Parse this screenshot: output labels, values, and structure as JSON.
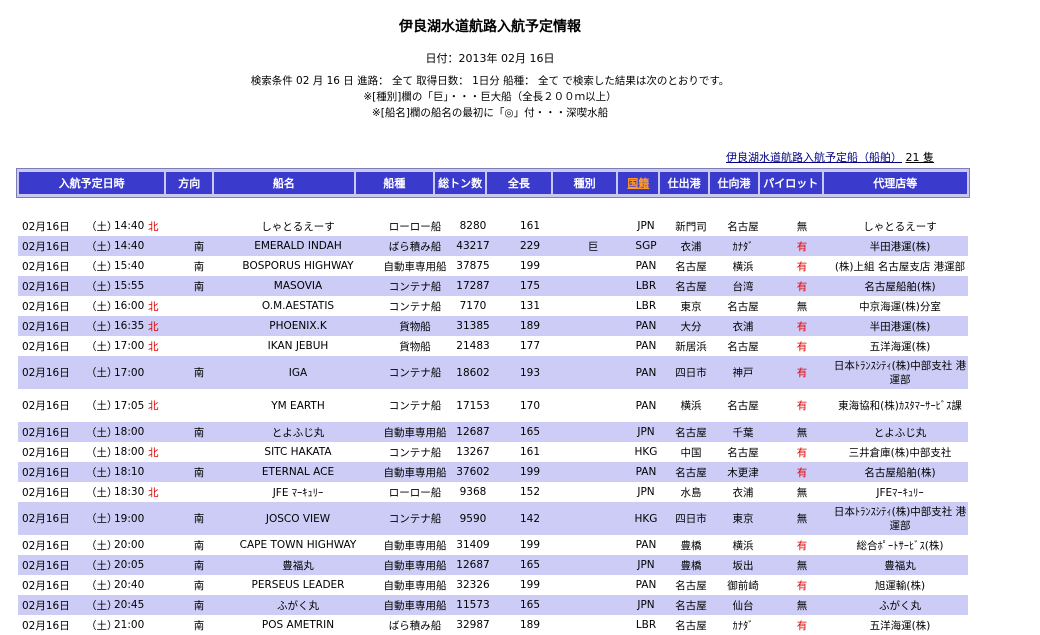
{
  "header": {
    "title": "伊良湖水道航路入航予定情報",
    "date_line": "日付：2013年 02月 16日",
    "condition_line": "検索条件 02 月 16 日 進路： 全て 取得日数： 1日分 船種： 全て で検索した結果は次のとおりです。",
    "note1": "※[種別]欄の「巨」・・・巨大船（全長２００ｍ以上）",
    "note2": "※[船名]欄の船名の最初に「◎」付・・・深喫水船"
  },
  "summary": {
    "link_text": "伊良湖水道航路入航予定船（船舶）",
    "count": "21 隻"
  },
  "columns": [
    "入航予定日時",
    "方向",
    "船名",
    "船種",
    "総トン数",
    "全長",
    "種別",
    "国籍",
    "仕出港",
    "仕向港",
    "パイロット",
    "代理店等"
  ],
  "rows": [
    {
      "date": "02月16日",
      "dow": "（土）",
      "time": "14:40",
      "dir": "北",
      "name": "しゃとるえーす",
      "type": "ローロー船",
      "gt": "8280",
      "len": "161",
      "cls": "",
      "flag": "JPN",
      "from": "新門司",
      "to": "名古屋",
      "pilot": "無",
      "agent": "しゃとるえーす"
    },
    {
      "date": "02月16日",
      "dow": "（土）",
      "time": "14:40",
      "dir": "南",
      "name": "EMERALD INDAH",
      "type": "ばら積み船",
      "gt": "43217",
      "len": "229",
      "cls": "巨",
      "flag": "SGP",
      "from": "衣浦",
      "to": "ｶﾅﾀﾞ",
      "pilot": "有",
      "agent": "半田港運(株)"
    },
    {
      "date": "02月16日",
      "dow": "（土）",
      "time": "15:40",
      "dir": "南",
      "name": "BOSPORUS HIGHWAY",
      "type": "自動車専用船",
      "gt": "37875",
      "len": "199",
      "cls": "",
      "flag": "PAN",
      "from": "名古屋",
      "to": "横浜",
      "pilot": "有",
      "agent": "(株)上組 名古屋支店 港運部"
    },
    {
      "date": "02月16日",
      "dow": "（土）",
      "time": "15:55",
      "dir": "南",
      "name": "MASOVIA",
      "type": "コンテナ船",
      "gt": "17287",
      "len": "175",
      "cls": "",
      "flag": "LBR",
      "from": "名古屋",
      "to": "台湾",
      "pilot": "有",
      "agent": "名古屋船舶(株)"
    },
    {
      "date": "02月16日",
      "dow": "（土）",
      "time": "16:00",
      "dir": "北",
      "name": "O.M.AESTATIS",
      "type": "コンテナ船",
      "gt": "7170",
      "len": "131",
      "cls": "",
      "flag": "LBR",
      "from": "東京",
      "to": "名古屋",
      "pilot": "無",
      "agent": "中京海運(株)分室"
    },
    {
      "date": "02月16日",
      "dow": "（土）",
      "time": "16:35",
      "dir": "北",
      "name": "PHOENIX.K",
      "type": "貨物船",
      "gt": "31385",
      "len": "189",
      "cls": "",
      "flag": "PAN",
      "from": "大分",
      "to": "衣浦",
      "pilot": "有",
      "agent": "半田港運(株)"
    },
    {
      "date": "02月16日",
      "dow": "（土）",
      "time": "17:00",
      "dir": "北",
      "name": "IKAN JEBUH",
      "type": "貨物船",
      "gt": "21483",
      "len": "177",
      "cls": "",
      "flag": "PAN",
      "from": "新居浜",
      "to": "名古屋",
      "pilot": "有",
      "agent": "五洋海運(株)"
    },
    {
      "date": "02月16日",
      "dow": "（土）",
      "time": "17:00",
      "dir": "南",
      "name": "IGA",
      "type": "コンテナ船",
      "gt": "18602",
      "len": "193",
      "cls": "",
      "flag": "PAN",
      "from": "四日市",
      "to": "神戸",
      "pilot": "有",
      "agent": "日本ﾄﾗﾝｽｼﾃｨ(株)中部支社 港運部"
    },
    {
      "date": "02月16日",
      "dow": "（土）",
      "time": "17:05",
      "dir": "北",
      "name": "YM EARTH",
      "type": "コンテナ船",
      "gt": "17153",
      "len": "170",
      "cls": "",
      "flag": "PAN",
      "from": "横浜",
      "to": "名古屋",
      "pilot": "有",
      "agent": "東海協和(株)ｶｽﾀﾏｰｻｰﾋﾞｽ課"
    },
    {
      "date": "02月16日",
      "dow": "（土）",
      "time": "18:00",
      "dir": "南",
      "name": "とよふじ丸",
      "type": "自動車専用船",
      "gt": "12687",
      "len": "165",
      "cls": "",
      "flag": "JPN",
      "from": "名古屋",
      "to": "千葉",
      "pilot": "無",
      "agent": "とよふじ丸"
    },
    {
      "date": "02月16日",
      "dow": "（土）",
      "time": "18:00",
      "dir": "北",
      "name": "SITC HAKATA",
      "type": "コンテナ船",
      "gt": "13267",
      "len": "161",
      "cls": "",
      "flag": "HKG",
      "from": "中国",
      "to": "名古屋",
      "pilot": "有",
      "agent": "三井倉庫(株)中部支社"
    },
    {
      "date": "02月16日",
      "dow": "（土）",
      "time": "18:10",
      "dir": "南",
      "name": "ETERNAL ACE",
      "type": "自動車専用船",
      "gt": "37602",
      "len": "199",
      "cls": "",
      "flag": "PAN",
      "from": "名古屋",
      "to": "木更津",
      "pilot": "有",
      "agent": "名古屋船舶(株)"
    },
    {
      "date": "02月16日",
      "dow": "（土）",
      "time": "18:30",
      "dir": "北",
      "name": "JFE ﾏｰｷｭﾘｰ",
      "type": "ローロー船",
      "gt": "9368",
      "len": "152",
      "cls": "",
      "flag": "JPN",
      "from": "水島",
      "to": "衣浦",
      "pilot": "無",
      "agent": "JFEﾏｰｷｭﾘｰ"
    },
    {
      "date": "02月16日",
      "dow": "（土）",
      "time": "19:00",
      "dir": "南",
      "name": "JOSCO VIEW",
      "type": "コンテナ船",
      "gt": "9590",
      "len": "142",
      "cls": "",
      "flag": "HKG",
      "from": "四日市",
      "to": "東京",
      "pilot": "無",
      "agent": "日本ﾄﾗﾝｽｼﾃｨ(株)中部支社 港運部"
    },
    {
      "date": "02月16日",
      "dow": "（土）",
      "time": "20:00",
      "dir": "南",
      "name": "CAPE TOWN HIGHWAY",
      "type": "自動車専用船",
      "gt": "31409",
      "len": "199",
      "cls": "",
      "flag": "PAN",
      "from": "豊橋",
      "to": "横浜",
      "pilot": "有",
      "agent": "総合ﾎﾟｰﾄｻｰﾋﾞｽ(株)"
    },
    {
      "date": "02月16日",
      "dow": "（土）",
      "time": "20:05",
      "dir": "南",
      "name": "豊福丸",
      "type": "自動車専用船",
      "gt": "12687",
      "len": "165",
      "cls": "",
      "flag": "JPN",
      "from": "豊橋",
      "to": "坂出",
      "pilot": "無",
      "agent": "豊福丸"
    },
    {
      "date": "02月16日",
      "dow": "（土）",
      "time": "20:40",
      "dir": "南",
      "name": "PERSEUS LEADER",
      "type": "自動車専用船",
      "gt": "32326",
      "len": "199",
      "cls": "",
      "flag": "PAN",
      "from": "名古屋",
      "to": "御前崎",
      "pilot": "有",
      "agent": "旭運輸(株)"
    },
    {
      "date": "02月16日",
      "dow": "（土）",
      "time": "20:45",
      "dir": "南",
      "name": "ふがく丸",
      "type": "自動車専用船",
      "gt": "11573",
      "len": "165",
      "cls": "",
      "flag": "JPN",
      "from": "名古屋",
      "to": "仙台",
      "pilot": "無",
      "agent": "ふがく丸"
    },
    {
      "date": "02月16日",
      "dow": "（土）",
      "time": "21:00",
      "dir": "南",
      "name": "POS AMETRIN",
      "type": "ばら積み船",
      "gt": "32987",
      "len": "189",
      "cls": "",
      "flag": "LBR",
      "from": "名古屋",
      "to": "ｶﾅﾀﾞ",
      "pilot": "有",
      "agent": "五洋海運(株)"
    }
  ],
  "colors": {
    "header_bg": "#3a3acc",
    "header_frame": "#c8c8f0",
    "row_alt": "#ccccf6",
    "north_red": "#e00000",
    "link_orange": "#ff9a2a"
  }
}
